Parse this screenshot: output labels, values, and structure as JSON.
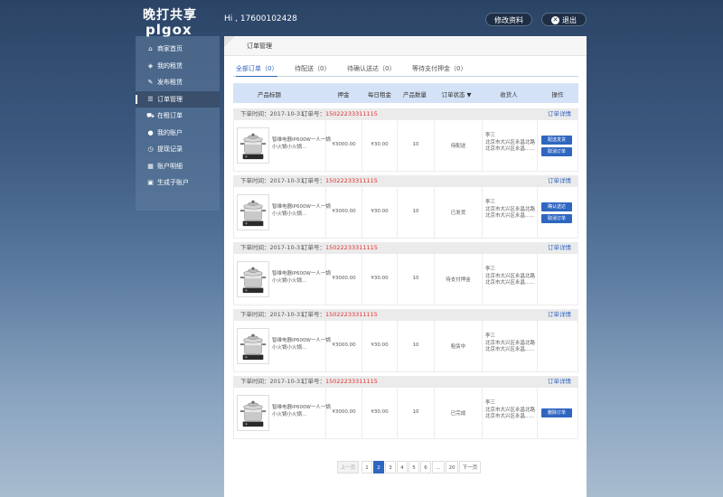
{
  "header": {
    "logo_cn": "晚打共享",
    "logo_en": "plgox",
    "greeting": "Hi , 17600102428",
    "profile_btn": "修改资料",
    "logout_btn": "退出"
  },
  "sidebar": {
    "items": [
      {
        "label": "商家首页",
        "icon": "home-icon",
        "glyph": "⌂"
      },
      {
        "label": "我的租赁",
        "icon": "shield-icon",
        "glyph": "◈"
      },
      {
        "label": "发布租赁",
        "icon": "edit-icon",
        "glyph": "✎"
      },
      {
        "label": "订单管理",
        "icon": "list-icon",
        "glyph": "☰"
      },
      {
        "label": "在租订单",
        "icon": "cart-icon",
        "glyph": "⛟"
      },
      {
        "label": "我的账户",
        "icon": "user-icon",
        "glyph": "●"
      },
      {
        "label": "提现记录",
        "icon": "clock-icon",
        "glyph": "◷"
      },
      {
        "label": "账户明细",
        "icon": "grid-icon",
        "glyph": "▦"
      },
      {
        "label": "生成子账户",
        "icon": "person-card-icon",
        "glyph": "▣"
      }
    ],
    "active": 3
  },
  "page_title": "订单管理",
  "tabs": [
    "全部订单（0）",
    "待配送（0）",
    "待确认送达（0）",
    "等待支付押金（0）"
  ],
  "table_headers": [
    "产品标题",
    "押金",
    "每日租金",
    "产品数量",
    "订单状态",
    "收货人",
    "操作"
  ],
  "orders": [
    {
      "time": "下单时间：2017-10-31",
      "order_no_label": "订单号：",
      "order_no": "15022233311115",
      "detail": "订单详情",
      "product": "智维电器IP600W一人一锅小火锅小火锅...",
      "deposit": "¥3000.00",
      "rent": "¥30.00",
      "qty": "10",
      "status": "待配送",
      "receiver": "李三",
      "addr1": "北京市大兴区永昌北路",
      "addr2": "北京市大兴区永昌......",
      "actions": [
        "配送发货",
        "取消订单"
      ]
    },
    {
      "time": "下单时间：2017-10-31",
      "order_no_label": "订单号：",
      "order_no": "15022233311115",
      "detail": "订单详情",
      "product": "智维电器IP600W一人一锅小火锅小火锅...",
      "deposit": "¥3000.00",
      "rent": "¥30.00",
      "qty": "10",
      "status": "已发货",
      "receiver": "李三",
      "addr1": "北京市大兴区永昌北路",
      "addr2": "北京市大兴区永昌......",
      "actions": [
        "确认送达",
        "取消订单"
      ]
    },
    {
      "time": "下单时间：2017-10-31",
      "order_no_label": "订单号：",
      "order_no": "15022233311115",
      "detail": "订单详情",
      "product": "智维电器IP600W一人一锅小火锅小火锅...",
      "deposit": "¥3000.00",
      "rent": "¥30.00",
      "qty": "10",
      "status": "待支付押金",
      "receiver": "李三",
      "addr1": "北京市大兴区永昌北路",
      "addr2": "北京市大兴区永昌......",
      "actions": []
    },
    {
      "time": "下单时间：2017-10-31",
      "order_no_label": "订单号：",
      "order_no": "15022233311115",
      "detail": "订单详情",
      "product": "智维电器IP600W一人一锅小火锅小火锅...",
      "deposit": "¥3000.00",
      "rent": "¥30.00",
      "qty": "10",
      "status": "租赁中",
      "receiver": "李三",
      "addr1": "北京市大兴区永昌北路",
      "addr2": "北京市大兴区永昌......",
      "actions": []
    },
    {
      "time": "下单时间：2017-10-31",
      "order_no_label": "订单号：",
      "order_no": "15022233311115",
      "detail": "订单详情",
      "product": "智维电器IP600W一人一锅小火锅小火锅...",
      "deposit": "¥3000.00",
      "rent": "¥30.00",
      "qty": "10",
      "status": "已完成",
      "receiver": "李三",
      "addr1": "北京市大兴区永昌北路",
      "addr2": "北京市大兴区永昌......",
      "actions": [
        "删除订单"
      ]
    }
  ],
  "pagination": {
    "prev": "上一页",
    "pages": [
      "1",
      "2",
      "3",
      "4",
      "5",
      "6",
      "...",
      "20"
    ],
    "current": "2",
    "next": "下一页"
  },
  "colors": {
    "accent": "#2f66c0",
    "order_no": "#e03030",
    "header_bg": "#d4e2f7"
  }
}
